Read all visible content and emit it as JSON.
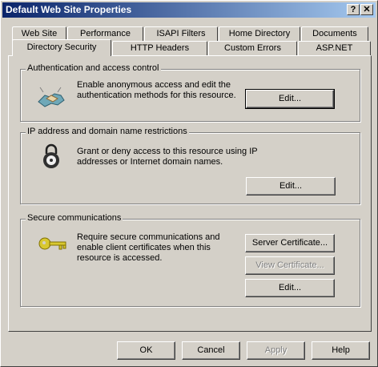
{
  "window": {
    "title": "Default Web Site Properties",
    "help_btn": "?",
    "close_btn": "X"
  },
  "tabs": {
    "row_back": [
      "Web Site",
      "Performance",
      "ISAPI Filters",
      "Home Directory",
      "Documents"
    ],
    "row_front": [
      "Directory Security",
      "HTTP Headers",
      "Custom Errors",
      "ASP.NET"
    ],
    "active": "Directory Security"
  },
  "auth": {
    "title": "Authentication and access control",
    "description": "Enable anonymous access and edit the authentication methods for this resource.",
    "edit_label": "Edit...",
    "icon": "handshake-icon"
  },
  "ip": {
    "title": "IP address and domain name restrictions",
    "description": "Grant or deny access to this resource using IP addresses or Internet domain names.",
    "edit_label": "Edit...",
    "icon": "padlock-icon"
  },
  "secure": {
    "title": "Secure communications",
    "description": "Require secure communications and enable client certificates when this resource is accessed.",
    "server_cert_label": "Server Certificate...",
    "view_cert_label": "View Certificate...",
    "edit_label": "Edit...",
    "icon": "key-icon"
  },
  "footer": {
    "ok": "OK",
    "cancel": "Cancel",
    "apply": "Apply",
    "help": "Help"
  },
  "colors": {
    "title_start": "#0a246a",
    "title_end": "#a6caf0",
    "face": "#d4d0c8"
  }
}
